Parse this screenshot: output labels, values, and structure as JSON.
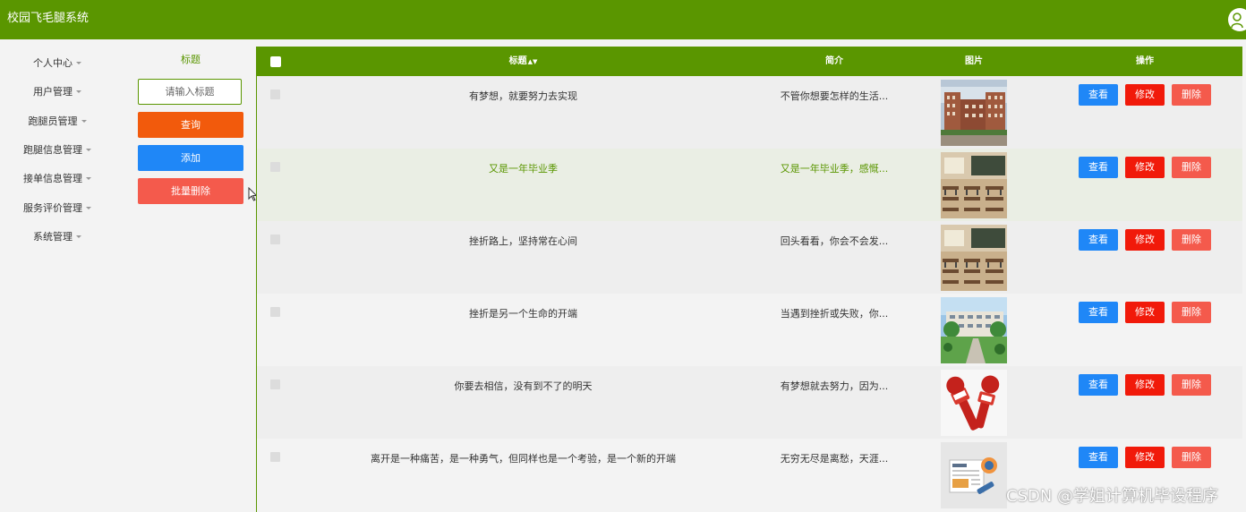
{
  "app": {
    "title": "校园飞毛腿系统"
  },
  "sidebar": {
    "items": [
      {
        "label": "个人中心"
      },
      {
        "label": "用户管理"
      },
      {
        "label": "跑腿员管理"
      },
      {
        "label": "跑腿信息管理"
      },
      {
        "label": "接单信息管理"
      },
      {
        "label": "服务评价管理"
      },
      {
        "label": "系统管理"
      }
    ]
  },
  "search": {
    "label": "标题",
    "placeholder": "请输入标题",
    "query_label": "查询",
    "add_label": "添加",
    "batch_delete_label": "批量删除"
  },
  "table": {
    "columns": {
      "title": "标题",
      "intro": "简介",
      "image": "图片",
      "actions": "操作"
    },
    "rows": [
      {
        "title": "有梦想，就要努力去实现",
        "intro": "不管你想要怎样的生活...",
        "image": "campus-building-photo"
      },
      {
        "title": "又是一年毕业季",
        "intro": "又是一年毕业季，感慨...",
        "image": "classroom-photo"
      },
      {
        "title": "挫折路上，坚持常在心间",
        "intro": "回头看看，你会不会发...",
        "image": "classroom-photo"
      },
      {
        "title": "挫折是另一个生命的开端",
        "intro": "当遇到挫折或失败，你...",
        "image": "campus-garden-photo"
      },
      {
        "title": "你要去相信，没有到不了的明天",
        "intro": "有梦想就去努力，因为...",
        "image": "live-microphone-icon"
      },
      {
        "title": "离开是一种痛苦，是一种勇气，但同样也是一个考验，是一个新的开端",
        "intro": "无穷无尽是离愁，天涯...",
        "image": "news-paper-icon"
      }
    ],
    "actions": {
      "view": "查看",
      "edit": "修改",
      "delete": "删除"
    }
  },
  "watermark": "CSDN @学姐计算机毕设程序",
  "colors": {
    "brand": "#5a9600",
    "query": "#f25a0c",
    "primary": "#1f87f7",
    "danger": "#f11a0a",
    "delete": "#f45a4c"
  }
}
